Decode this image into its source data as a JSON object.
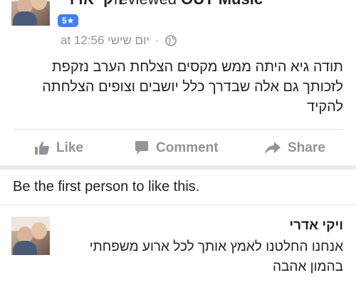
{
  "post": {
    "author_name": "ויקי אדרי",
    "reviewed_word": "reviewed",
    "page_name": "OUT Music",
    "rating": "5★",
    "timestamp": "יום שישי at 12:56",
    "separator": "·",
    "privacy_icon": "globe-icon",
    "text_lines": [
      "תודה גיא היתה ממש מקסים הצלחת הערב נזקפת",
      "לזכותך גם אלה שבדרך כלל יושבים וצופים הצלחתה",
      "להקיד"
    ]
  },
  "actions": {
    "like_label": "Like",
    "comment_label": "Comment",
    "share_label": "Share"
  },
  "likes_summary": "Be the first person to like this.",
  "comment": {
    "author_name": "ויקי אדרי",
    "text_lines": [
      "אנחנו החלטנו לאמץ אותך לכל ארוע משפחתי",
      "בהמון אהבה"
    ]
  },
  "colors": {
    "accent": "#4080ff",
    "muted_text": "#90949c",
    "divider": "#e5e6e9"
  }
}
